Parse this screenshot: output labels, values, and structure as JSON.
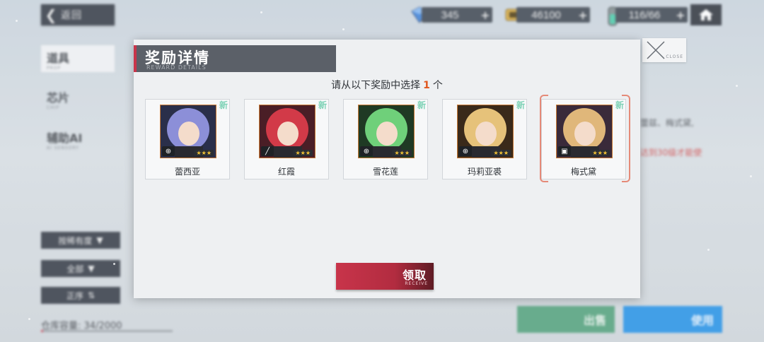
{
  "top_bar": {
    "back_label": "返回",
    "gems": "345",
    "credits": "46100",
    "stamina": "116/66"
  },
  "sidebar": {
    "tabs": [
      {
        "label": "道具",
        "sub": "PROP"
      },
      {
        "label": "芯片",
        "sub": "CHIP"
      },
      {
        "label": "辅助AI",
        "sub": "AI SENSORY"
      }
    ],
    "filters": [
      "按稀有度",
      "全部",
      "正序"
    ],
    "capacity_label": "仓库容量:",
    "capacity_value": "34/2000",
    "capacity_fill": 0.017
  },
  "right_panel": {
    "text_line1": "蕾兹、梅式黛,",
    "text_line2": "达到30级才能使",
    "sell_label": "出售",
    "use_label": "使用"
  },
  "dialog": {
    "title": "奖励详情",
    "subtitle": "REWARD DETAILS",
    "close_label": "CLOSE",
    "instruction_prefix": "请从以下奖励中选择",
    "instruction_count": "1",
    "instruction_suffix": "个",
    "new_tag": "新",
    "stars": "★★★",
    "cards": [
      {
        "name": "蕾西亚",
        "role_icon": "crosshair-icon",
        "selected": false,
        "hair": "#8c8fd8",
        "bg": "#2a2f4a"
      },
      {
        "name": "红霞",
        "role_icon": "blade-icon",
        "selected": false,
        "hair": "#d23a48",
        "bg": "#4a1e26"
      },
      {
        "name": "雪花莲",
        "role_icon": "crosshair-icon",
        "selected": false,
        "hair": "#6fd07a",
        "bg": "#1f3a24"
      },
      {
        "name": "玛莉亚裘",
        "role_icon": "crosshair-icon",
        "selected": false,
        "hair": "#e6c27a",
        "bg": "#3a2a1a"
      },
      {
        "name": "梅式黛",
        "role_icon": "shield-icon",
        "selected": true,
        "hair": "#e0b77a",
        "bg": "#3a2a3a"
      }
    ],
    "receive_label": "领取",
    "receive_sub": "RECEIVE"
  },
  "colors": {
    "accent_red": "#c8344a",
    "highlight_orange": "#e0561e",
    "new_tag_green": "#7dd2b6"
  }
}
